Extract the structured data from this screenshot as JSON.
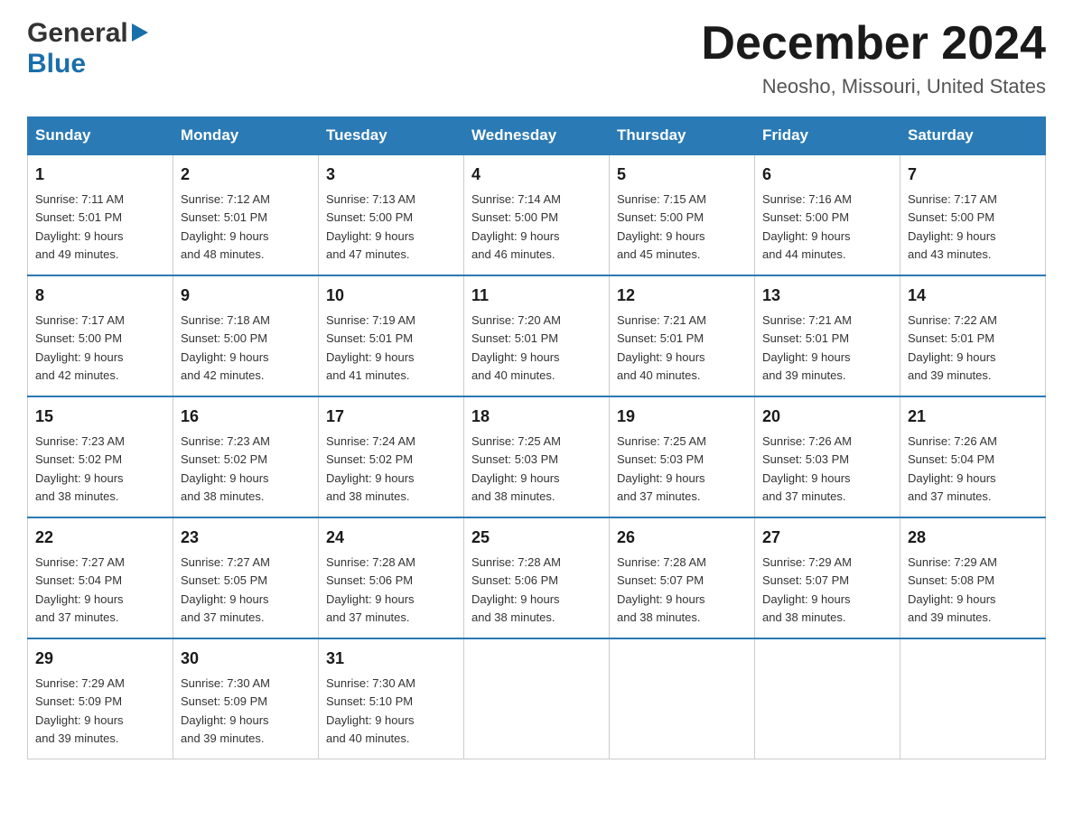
{
  "logo": {
    "general": "General",
    "blue": "Blue"
  },
  "title": "December 2024",
  "subtitle": "Neosho, Missouri, United States",
  "days_of_week": [
    "Sunday",
    "Monday",
    "Tuesday",
    "Wednesday",
    "Thursday",
    "Friday",
    "Saturday"
  ],
  "weeks": [
    [
      {
        "day": "1",
        "sunrise": "7:11 AM",
        "sunset": "5:01 PM",
        "daylight": "9 hours and 49 minutes."
      },
      {
        "day": "2",
        "sunrise": "7:12 AM",
        "sunset": "5:01 PM",
        "daylight": "9 hours and 48 minutes."
      },
      {
        "day": "3",
        "sunrise": "7:13 AM",
        "sunset": "5:00 PM",
        "daylight": "9 hours and 47 minutes."
      },
      {
        "day": "4",
        "sunrise": "7:14 AM",
        "sunset": "5:00 PM",
        "daylight": "9 hours and 46 minutes."
      },
      {
        "day": "5",
        "sunrise": "7:15 AM",
        "sunset": "5:00 PM",
        "daylight": "9 hours and 45 minutes."
      },
      {
        "day": "6",
        "sunrise": "7:16 AM",
        "sunset": "5:00 PM",
        "daylight": "9 hours and 44 minutes."
      },
      {
        "day": "7",
        "sunrise": "7:17 AM",
        "sunset": "5:00 PM",
        "daylight": "9 hours and 43 minutes."
      }
    ],
    [
      {
        "day": "8",
        "sunrise": "7:17 AM",
        "sunset": "5:00 PM",
        "daylight": "9 hours and 42 minutes."
      },
      {
        "day": "9",
        "sunrise": "7:18 AM",
        "sunset": "5:00 PM",
        "daylight": "9 hours and 42 minutes."
      },
      {
        "day": "10",
        "sunrise": "7:19 AM",
        "sunset": "5:01 PM",
        "daylight": "9 hours and 41 minutes."
      },
      {
        "day": "11",
        "sunrise": "7:20 AM",
        "sunset": "5:01 PM",
        "daylight": "9 hours and 40 minutes."
      },
      {
        "day": "12",
        "sunrise": "7:21 AM",
        "sunset": "5:01 PM",
        "daylight": "9 hours and 40 minutes."
      },
      {
        "day": "13",
        "sunrise": "7:21 AM",
        "sunset": "5:01 PM",
        "daylight": "9 hours and 39 minutes."
      },
      {
        "day": "14",
        "sunrise": "7:22 AM",
        "sunset": "5:01 PM",
        "daylight": "9 hours and 39 minutes."
      }
    ],
    [
      {
        "day": "15",
        "sunrise": "7:23 AM",
        "sunset": "5:02 PM",
        "daylight": "9 hours and 38 minutes."
      },
      {
        "day": "16",
        "sunrise": "7:23 AM",
        "sunset": "5:02 PM",
        "daylight": "9 hours and 38 minutes."
      },
      {
        "day": "17",
        "sunrise": "7:24 AM",
        "sunset": "5:02 PM",
        "daylight": "9 hours and 38 minutes."
      },
      {
        "day": "18",
        "sunrise": "7:25 AM",
        "sunset": "5:03 PM",
        "daylight": "9 hours and 38 minutes."
      },
      {
        "day": "19",
        "sunrise": "7:25 AM",
        "sunset": "5:03 PM",
        "daylight": "9 hours and 37 minutes."
      },
      {
        "day": "20",
        "sunrise": "7:26 AM",
        "sunset": "5:03 PM",
        "daylight": "9 hours and 37 minutes."
      },
      {
        "day": "21",
        "sunrise": "7:26 AM",
        "sunset": "5:04 PM",
        "daylight": "9 hours and 37 minutes."
      }
    ],
    [
      {
        "day": "22",
        "sunrise": "7:27 AM",
        "sunset": "5:04 PM",
        "daylight": "9 hours and 37 minutes."
      },
      {
        "day": "23",
        "sunrise": "7:27 AM",
        "sunset": "5:05 PM",
        "daylight": "9 hours and 37 minutes."
      },
      {
        "day": "24",
        "sunrise": "7:28 AM",
        "sunset": "5:06 PM",
        "daylight": "9 hours and 37 minutes."
      },
      {
        "day": "25",
        "sunrise": "7:28 AM",
        "sunset": "5:06 PM",
        "daylight": "9 hours and 38 minutes."
      },
      {
        "day": "26",
        "sunrise": "7:28 AM",
        "sunset": "5:07 PM",
        "daylight": "9 hours and 38 minutes."
      },
      {
        "day": "27",
        "sunrise": "7:29 AM",
        "sunset": "5:07 PM",
        "daylight": "9 hours and 38 minutes."
      },
      {
        "day": "28",
        "sunrise": "7:29 AM",
        "sunset": "5:08 PM",
        "daylight": "9 hours and 39 minutes."
      }
    ],
    [
      {
        "day": "29",
        "sunrise": "7:29 AM",
        "sunset": "5:09 PM",
        "daylight": "9 hours and 39 minutes."
      },
      {
        "day": "30",
        "sunrise": "7:30 AM",
        "sunset": "5:09 PM",
        "daylight": "9 hours and 39 minutes."
      },
      {
        "day": "31",
        "sunrise": "7:30 AM",
        "sunset": "5:10 PM",
        "daylight": "9 hours and 40 minutes."
      },
      null,
      null,
      null,
      null
    ]
  ],
  "labels": {
    "sunrise": "Sunrise:",
    "sunset": "Sunset:",
    "daylight": "Daylight:"
  }
}
